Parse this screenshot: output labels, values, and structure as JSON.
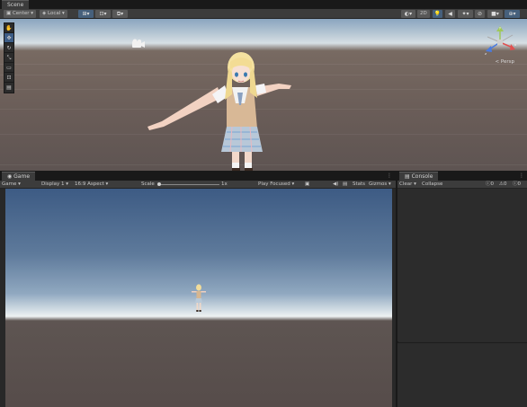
{
  "scene": {
    "tab_label": "Scene",
    "toolbar": {
      "pivot": "Center",
      "space": "Local",
      "mode_2d": "2D"
    },
    "camera_mode": "< Persp",
    "gizmo_axes": [
      "y",
      "x",
      "z"
    ],
    "tools": [
      "hand",
      "move",
      "rotate",
      "scale",
      "rect",
      "transform",
      "custom"
    ]
  },
  "game": {
    "tab_label": "Game",
    "toolbar": {
      "view_type": "Game",
      "display": "Display 1",
      "aspect": "16:9 Aspect",
      "scale_label": "Scale",
      "scale_value": "1x",
      "play_mode": "Play Focused",
      "stats": "Stats",
      "gizmos": "Gizmos"
    }
  },
  "console": {
    "tab_label": "Console",
    "clear": "Clear",
    "collapse": "Collapse",
    "error_count": "0",
    "warning_count": "0",
    "log_count": "0"
  },
  "colors": {
    "accent": "#46607c",
    "panel": "#3c3c3c",
    "background": "#191919"
  }
}
